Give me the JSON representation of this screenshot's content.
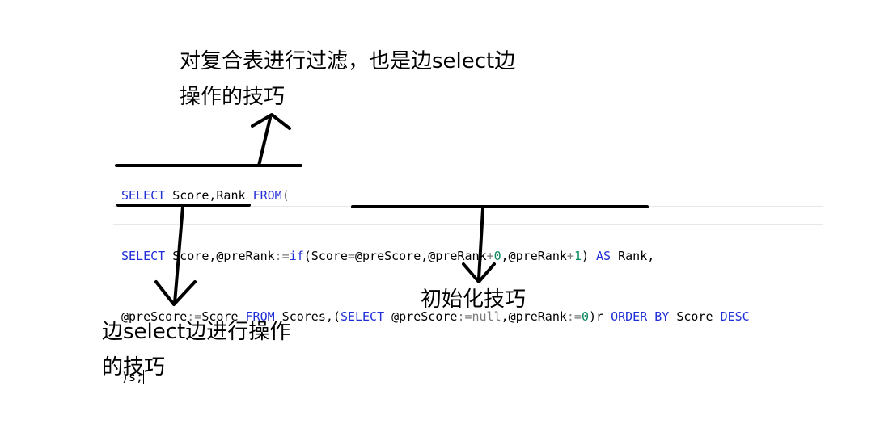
{
  "annotations": {
    "top_line1": "对复合表进行过滤，也是边select边",
    "top_line2": "操作的技巧",
    "left_line1": "边select边进行操作",
    "left_line2": "的技巧",
    "bottom": "初始化技巧"
  },
  "code": {
    "line1": [
      {
        "t": "SELECT",
        "c": "kw"
      },
      {
        "t": " Score,Rank ",
        "c": ""
      },
      {
        "t": "FROM",
        "c": "kw"
      },
      {
        "t": "(",
        "c": "op"
      }
    ],
    "line2": [
      {
        "t": "SELECT",
        "c": "kw"
      },
      {
        "t": " Score,@preRank",
        "c": ""
      },
      {
        "t": ":=",
        "c": "op"
      },
      {
        "t": "if",
        "c": "kw"
      },
      {
        "t": "(Score",
        "c": ""
      },
      {
        "t": "=",
        "c": "op"
      },
      {
        "t": "@preScore,@preRank",
        "c": ""
      },
      {
        "t": "+",
        "c": "op"
      },
      {
        "t": "0",
        "c": "num"
      },
      {
        "t": ",@preRank",
        "c": ""
      },
      {
        "t": "+",
        "c": "op"
      },
      {
        "t": "1",
        "c": "num"
      },
      {
        "t": ") ",
        "c": ""
      },
      {
        "t": "AS",
        "c": "kw"
      },
      {
        "t": " Rank,",
        "c": ""
      }
    ],
    "line3": [
      {
        "t": "@preScore",
        "c": ""
      },
      {
        "t": ":=",
        "c": "op"
      },
      {
        "t": "Score ",
        "c": ""
      },
      {
        "t": "FROM",
        "c": "kw"
      },
      {
        "t": " Scores,(",
        "c": ""
      },
      {
        "t": "SELECT",
        "c": "kw"
      },
      {
        "t": " @preScore",
        "c": ""
      },
      {
        "t": ":=",
        "c": "op"
      },
      {
        "t": "null",
        "c": "op"
      },
      {
        "t": ",@preRank",
        "c": ""
      },
      {
        "t": ":=",
        "c": "op"
      },
      {
        "t": "0",
        "c": "num"
      },
      {
        "t": ")r ",
        "c": ""
      },
      {
        "t": "ORDER BY",
        "c": "kw"
      },
      {
        "t": " Score ",
        "c": ""
      },
      {
        "t": "DESC",
        "c": "kw"
      }
    ],
    "line4": [
      {
        "t": ")s;",
        "c": ""
      }
    ]
  }
}
